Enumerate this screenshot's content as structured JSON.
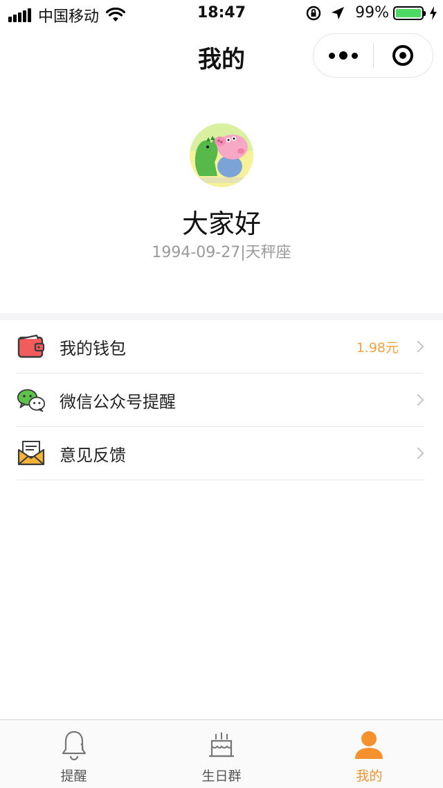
{
  "status_bar": {
    "carrier": "中国移动",
    "time": "18:47",
    "battery": "99%",
    "battery_level": 0.99
  },
  "nav": {
    "title": "我的"
  },
  "profile": {
    "name": "大家好",
    "info": "1994-09-27|天秤座"
  },
  "menu": {
    "items": [
      {
        "label": "我的钱包",
        "value": "1.98元",
        "icon": "wallet-icon"
      },
      {
        "label": "微信公众号提醒",
        "value": "",
        "icon": "wechat-icon"
      },
      {
        "label": "意见反馈",
        "value": "",
        "icon": "envelope-icon"
      }
    ]
  },
  "tabbar": {
    "tabs": [
      {
        "label": "提醒",
        "icon": "bell-icon",
        "active": false
      },
      {
        "label": "生日群",
        "icon": "cake-icon",
        "active": false
      },
      {
        "label": "我的",
        "icon": "person-icon",
        "active": true
      }
    ]
  },
  "colors": {
    "accent": "#f5922e",
    "battery": "#4cd964",
    "wallet": "#f25c5c",
    "wechat": "#5dc34b",
    "envelope": "#f5b33a"
  }
}
